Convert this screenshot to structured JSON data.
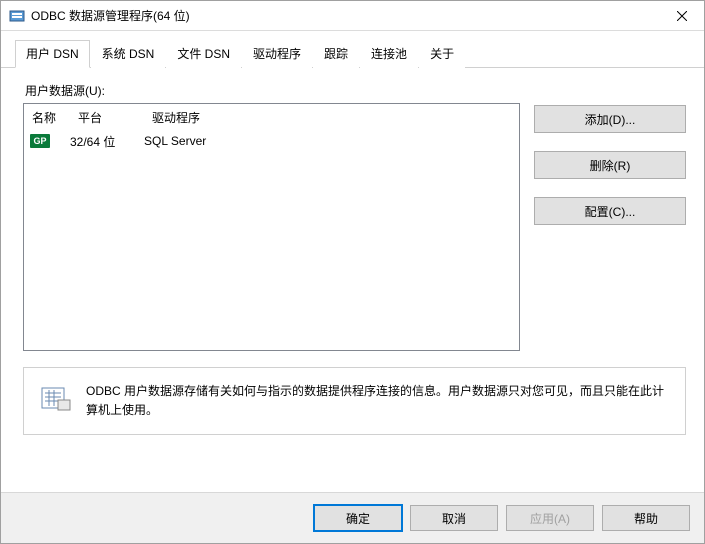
{
  "window": {
    "title": "ODBC 数据源管理程序(64 位)"
  },
  "tabs": [
    {
      "label": "用户 DSN",
      "active": true
    },
    {
      "label": "系统 DSN",
      "active": false
    },
    {
      "label": "文件 DSN",
      "active": false
    },
    {
      "label": "驱动程序",
      "active": false
    },
    {
      "label": "跟踪",
      "active": false
    },
    {
      "label": "连接池",
      "active": false
    },
    {
      "label": "关于",
      "active": false
    }
  ],
  "content": {
    "list_label": "用户数据源(U):",
    "columns": {
      "name": "名称",
      "platform": "平台",
      "driver": "驱动程序"
    },
    "rows": [
      {
        "icon": "GP",
        "name": "",
        "platform": "32/64 位",
        "driver": "SQL Server"
      }
    ],
    "buttons": {
      "add": "添加(D)...",
      "remove": "删除(R)",
      "configure": "配置(C)..."
    },
    "info": "ODBC 用户数据源存储有关如何与指示的数据提供程序连接的信息。用户数据源只对您可见，而且只能在此计算机上使用。"
  },
  "dialog_buttons": {
    "ok": "确定",
    "cancel": "取消",
    "apply": "应用(A)",
    "help": "帮助"
  }
}
